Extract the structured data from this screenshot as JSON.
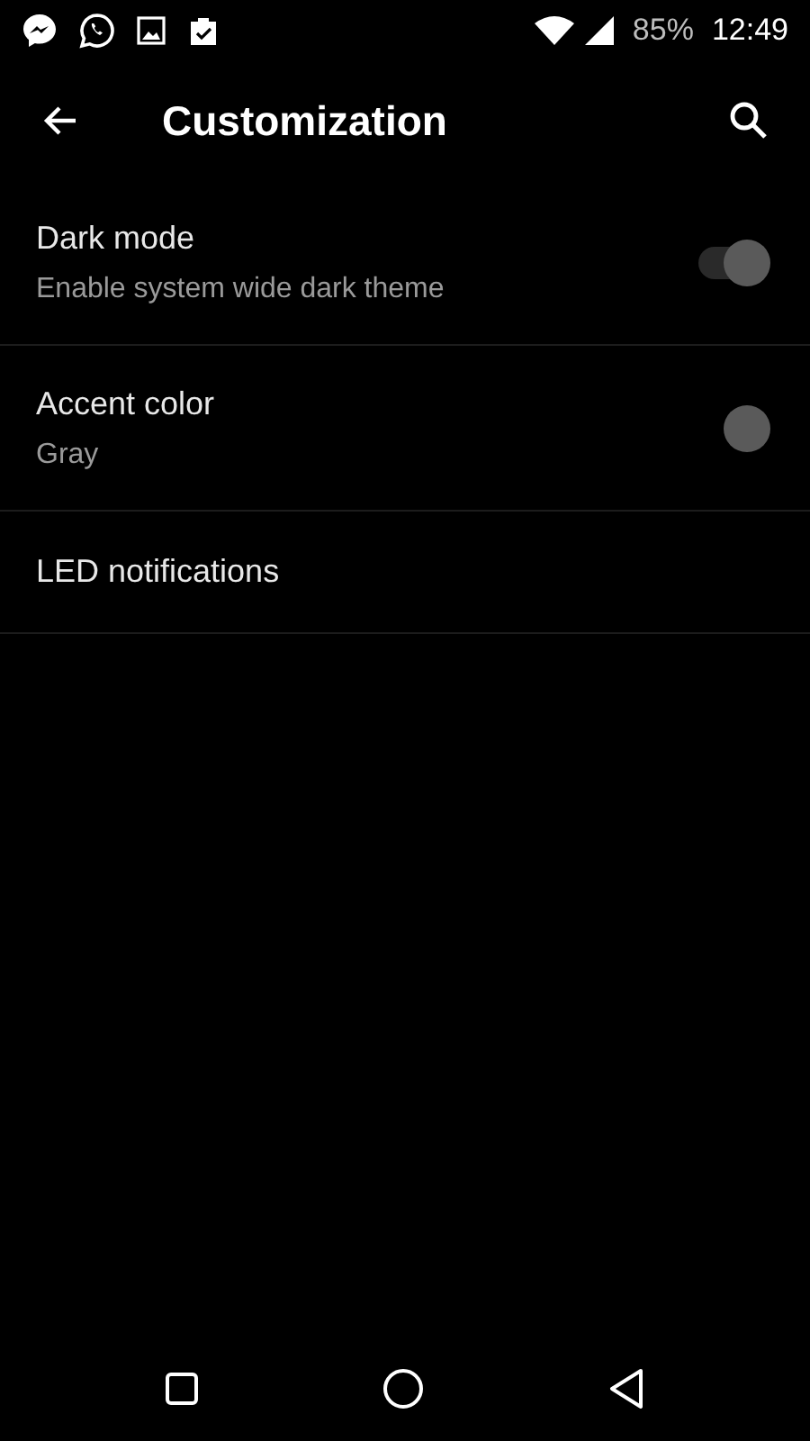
{
  "status_bar": {
    "battery": "85%",
    "time": "12:49"
  },
  "toolbar": {
    "title": "Customization"
  },
  "settings": [
    {
      "kind": "switch",
      "title": "Dark mode",
      "summary": "Enable system wide dark theme",
      "on": true
    },
    {
      "kind": "color",
      "title": "Accent color",
      "summary": "Gray",
      "color": "#5a5a5a"
    },
    {
      "kind": "plain",
      "title": "LED notifications"
    }
  ]
}
